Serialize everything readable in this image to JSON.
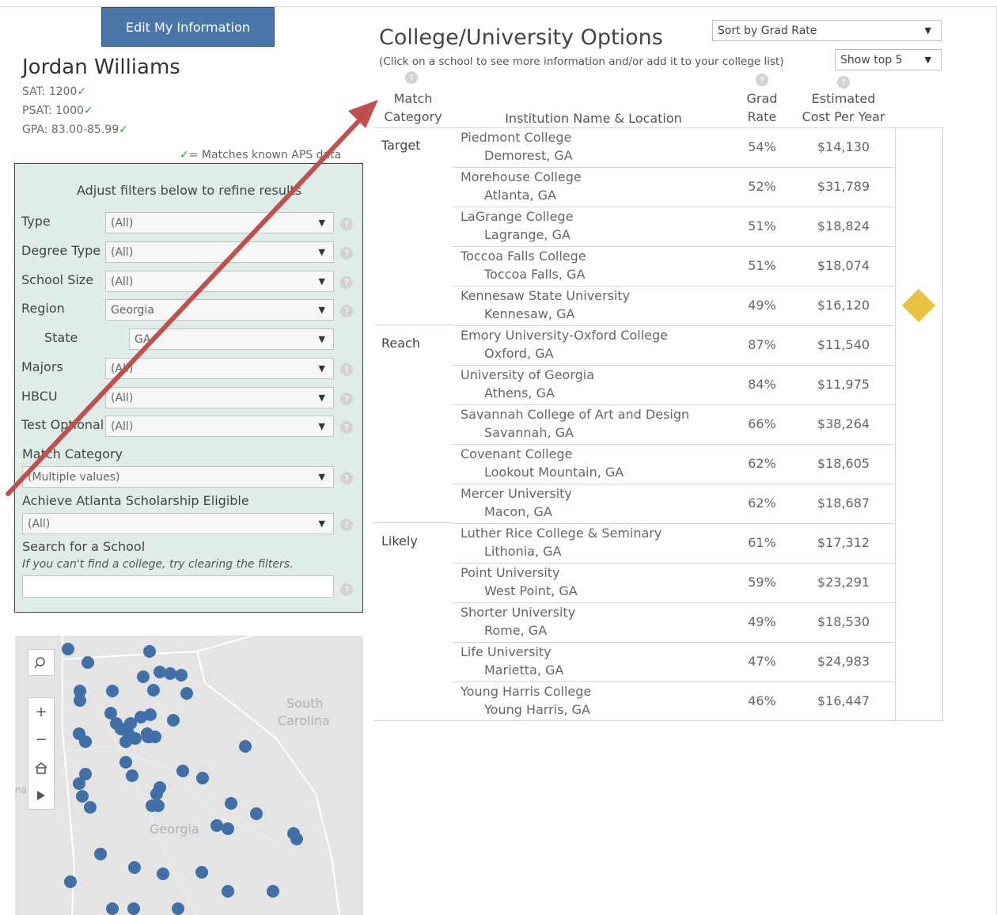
{
  "profile": {
    "edit_button": "Edit My Information",
    "name": "Jordan Williams",
    "sat": "SAT: 1200",
    "psat": "PSAT: 1000",
    "gpa": "GPA: 83.00-85.99",
    "check_glyph": "✓",
    "legend_text": "= Matches known APS data"
  },
  "filters": {
    "title": "Adjust filters below to refine results",
    "help_glyph": "?",
    "caret_glyph": "▼",
    "rows": [
      {
        "label": "Type",
        "value": "(All)"
      },
      {
        "label": "Degree Type",
        "value": "(All)"
      },
      {
        "label": "School Size",
        "value": "(All)"
      },
      {
        "label": "Region",
        "value": "Georgia"
      },
      {
        "label": "State",
        "value": "GA"
      },
      {
        "label": "Majors",
        "value": "(All)"
      },
      {
        "label": "HBCU",
        "value": "(All)"
      },
      {
        "label": "Test Optional",
        "value": "(All)"
      }
    ],
    "match_category": {
      "label": "Match Category",
      "value": "(Multiple values)"
    },
    "achieve_atlanta": {
      "label": "Achieve Atlanta Scholarship Eligible",
      "value": "(All)"
    },
    "search": {
      "label": "Search for a School",
      "hint": "If you can't find a college, try clearing the filters.",
      "value": ""
    }
  },
  "map": {
    "labels": {
      "south_carolina_1": "South",
      "south_carolina_2": "Carolina",
      "georgia": "Georgia",
      "edge": "na"
    },
    "controls": {
      "search_icon": "search-icon",
      "zoom_in": "+",
      "zoom_out": "−",
      "home_icon": "home-icon",
      "play_icon": "play-icon"
    },
    "marker_color": "#4170a8"
  },
  "results": {
    "title": "College/University Options",
    "subtitle": "(Click on a school to see more information and/or add it to your college list)",
    "sort_select": "Sort by Grad Rate",
    "show_select": "Show top 5",
    "columns": {
      "match_1": "Match",
      "match_2": "Category",
      "institution": "Institution Name & Location",
      "grad_1": "Grad",
      "grad_2": "Rate",
      "cost_1": "Estimated",
      "cost_2": "Cost Per Year"
    },
    "groups": [
      {
        "category": "Target",
        "rows": [
          {
            "name": "Piedmont College",
            "location": "Demorest, GA",
            "grad_rate": "54%",
            "cost": "$14,130",
            "flag": false
          },
          {
            "name": "Morehouse College",
            "location": "Atlanta, GA",
            "grad_rate": "52%",
            "cost": "$31,789",
            "flag": false
          },
          {
            "name": "LaGrange College",
            "location": "Lagrange, GA",
            "grad_rate": "51%",
            "cost": "$18,824",
            "flag": false
          },
          {
            "name": "Toccoa Falls College",
            "location": "Toccoa Falls, GA",
            "grad_rate": "51%",
            "cost": "$18,074",
            "flag": false
          },
          {
            "name": "Kennesaw State University",
            "location": "Kennesaw, GA",
            "grad_rate": "49%",
            "cost": "$16,120",
            "flag": true
          }
        ]
      },
      {
        "category": "Reach",
        "rows": [
          {
            "name": "Emory University-Oxford College",
            "location": "Oxford, GA",
            "grad_rate": "87%",
            "cost": "$11,540",
            "flag": false
          },
          {
            "name": "University of Georgia",
            "location": "Athens, GA",
            "grad_rate": "84%",
            "cost": "$11,975",
            "flag": false
          },
          {
            "name": "Savannah College of Art and Design",
            "location": "Savannah, GA",
            "grad_rate": "66%",
            "cost": "$38,264",
            "flag": false
          },
          {
            "name": "Covenant College",
            "location": "Lookout Mountain, GA",
            "grad_rate": "62%",
            "cost": "$18,605",
            "flag": false
          },
          {
            "name": "Mercer University",
            "location": "Macon, GA",
            "grad_rate": "62%",
            "cost": "$18,687",
            "flag": false
          }
        ]
      },
      {
        "category": "Likely",
        "rows": [
          {
            "name": "Luther Rice College & Seminary",
            "location": "Lithonia, GA",
            "grad_rate": "61%",
            "cost": "$17,312",
            "flag": false
          },
          {
            "name": "Point University",
            "location": "West Point, GA",
            "grad_rate": "59%",
            "cost": "$23,291",
            "flag": false
          },
          {
            "name": "Shorter University",
            "location": "Rome, GA",
            "grad_rate": "49%",
            "cost": "$18,530",
            "flag": false
          },
          {
            "name": "Life University",
            "location": "Marietta, GA",
            "grad_rate": "47%",
            "cost": "$24,983",
            "flag": false
          },
          {
            "name": "Young Harris College",
            "location": "Young Harris, GA",
            "grad_rate": "46%",
            "cost": "$16,447",
            "flag": false
          }
        ]
      }
    ]
  },
  "colors": {
    "accent_button": "#4a76a8",
    "filter_panel": "#dfece9",
    "arrow": "#c0504d",
    "flag_diamond": "#e8c243",
    "check": "#2ca02c"
  }
}
